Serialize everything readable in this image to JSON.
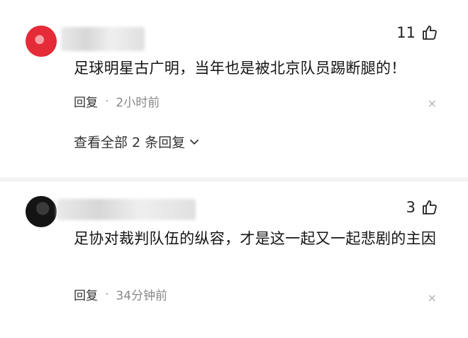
{
  "comments": [
    {
      "likes": "11",
      "text": "足球明星古广明，当年也是被北京队员踢断腿的！",
      "reply_label": "回复",
      "separator": "·",
      "time": "2小时前",
      "view_replies": "查看全部 2 条回复",
      "close": "×"
    },
    {
      "likes": "3",
      "text": "足协对裁判队伍的纵容，才是这一起又一起悲剧的主因",
      "reply_label": "回复",
      "separator": "·",
      "time": "34分钟前",
      "close": "×"
    }
  ],
  "icons": {
    "like": "thumbs-up-icon",
    "close": "close-icon",
    "expand": "chevron-down-icon"
  },
  "colors": {
    "text": "#141414",
    "meta": "#888888",
    "avatar1": "#e62b38",
    "avatar2": "#141414"
  }
}
